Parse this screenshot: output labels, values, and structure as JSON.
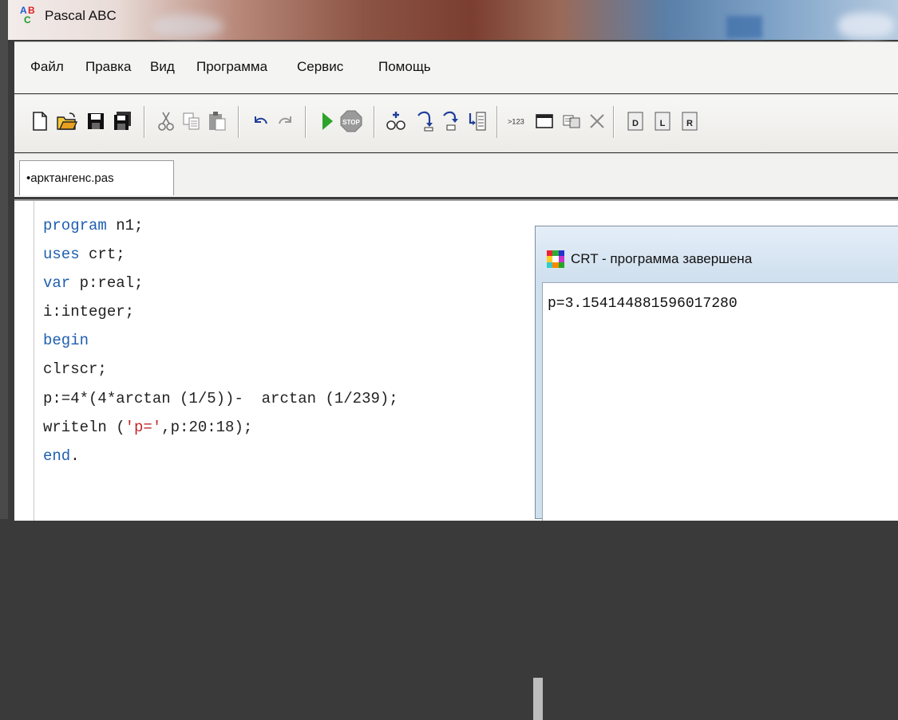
{
  "app": {
    "title": "Pascal ABC"
  },
  "menu": [
    "Файл",
    "Правка",
    "Вид",
    "Программа",
    "Сервис",
    "Помощь"
  ],
  "toolbar_icons": [
    "new-file-icon",
    "open-file-icon",
    "save-icon",
    "save-all-icon",
    "cut-icon",
    "copy-icon",
    "paste-icon",
    "undo-icon",
    "redo-icon",
    "run-icon",
    "stop-icon",
    "watch-icon",
    "step-into-icon",
    "step-over-icon",
    "run-to-cursor-icon",
    "evaluate-icon",
    "output-window-icon",
    "debug-icon",
    "close-icon",
    "compile-d-icon",
    "compile-l-icon",
    "compile-r-icon"
  ],
  "tab": {
    "label": "•арктангенс.pas"
  },
  "code": [
    {
      "parts": [
        {
          "t": "program",
          "k": true
        },
        {
          "t": " n1;"
        }
      ]
    },
    {
      "parts": [
        {
          "t": "uses",
          "k": true
        },
        {
          "t": " crt;"
        }
      ]
    },
    {
      "parts": [
        {
          "t": "var",
          "k": true
        },
        {
          "t": " p:real;"
        }
      ]
    },
    {
      "parts": [
        {
          "t": "i:integer;"
        }
      ]
    },
    {
      "parts": [
        {
          "t": "begin",
          "k": true
        }
      ]
    },
    {
      "parts": [
        {
          "t": "clrscr;"
        }
      ]
    },
    {
      "parts": [
        {
          "t": "p:=4*(4*arctan (1/5))-  arctan (1/239);"
        }
      ]
    },
    {
      "parts": [
        {
          "t": "writeln ("
        },
        {
          "t": "'p='",
          "s": true
        },
        {
          "t": ",p:20:18);"
        }
      ]
    },
    {
      "parts": [
        {
          "t": "end",
          "k": true
        },
        {
          "t": "."
        }
      ]
    }
  ],
  "crt": {
    "title": "CRT - программа завершена",
    "output": "p=3.154144881596017280"
  }
}
